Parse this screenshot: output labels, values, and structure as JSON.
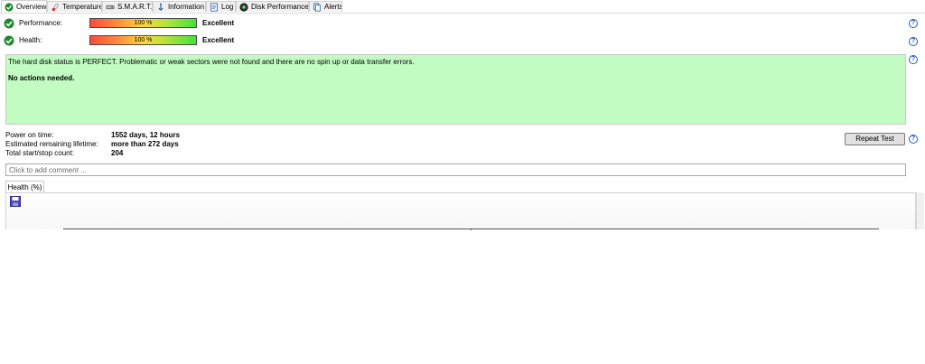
{
  "tabs": [
    {
      "label": "Overview",
      "icon": "check-circle-icon",
      "active": true
    },
    {
      "label": "Temperature",
      "icon": "thermometer-icon",
      "active": false
    },
    {
      "label": "S.M.A.R.T.",
      "icon": "hard-disk-icon",
      "active": false
    },
    {
      "label": "Information",
      "icon": "info-icon",
      "active": false
    },
    {
      "label": "Log",
      "icon": "log-icon",
      "active": false
    },
    {
      "label": "Disk Performance",
      "icon": "disk-performance-icon",
      "active": false
    },
    {
      "label": "Alerts",
      "icon": "alerts-icon",
      "active": false
    }
  ],
  "performance": {
    "label": "Performance:",
    "percent_text": "100 %",
    "percent": 100,
    "rating": "Excellent"
  },
  "health": {
    "label": "Health:",
    "percent_text": "100 %",
    "percent": 100,
    "rating": "Excellent"
  },
  "status": {
    "message": "The hard disk status is PERFECT. Problematic or weak sectors were not found and there are no spin up or data transfer errors.",
    "action": "No actions needed."
  },
  "info": {
    "power_on_label": "Power on time:",
    "power_on_value": "1552 days, 12 hours",
    "lifetime_label": "Estimated remaining lifetime:",
    "lifetime_value": "more than 272 days",
    "startstop_label": "Total start/stop count:",
    "startstop_value": "204"
  },
  "repeat_test_label": "Repeat Test",
  "help_label": "?",
  "comment_placeholder": "Click to add comment ...",
  "chart_tab_label": "Health (%)",
  "colors": {
    "status_background": "#c2fcc2",
    "check_green": "#1f8a2e",
    "help_blue": "#1f5fbf"
  }
}
